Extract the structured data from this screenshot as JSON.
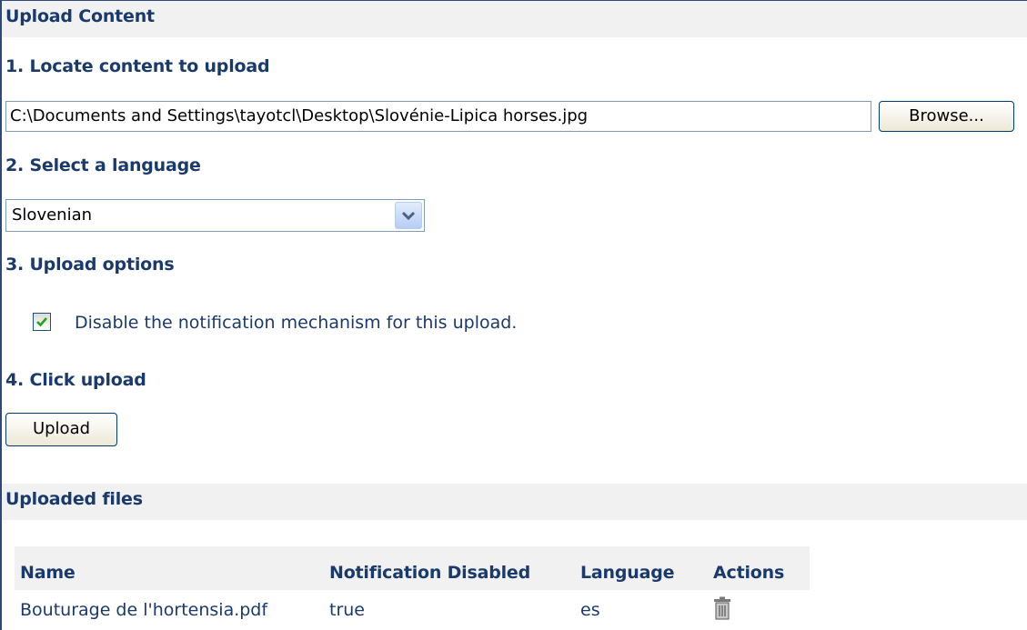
{
  "header": {
    "title": "Upload Content"
  },
  "steps": {
    "locate": {
      "title": "1. Locate content to upload",
      "file_value": "C:\\Documents and Settings\\tayotcl\\Desktop\\Slovénie-Lipica horses.jpg",
      "browse_label": "Browse..."
    },
    "language": {
      "title": "2. Select a language",
      "selected": "Slovenian"
    },
    "options": {
      "title": "3. Upload options",
      "notification_label": "Disable the notification mechanism for this upload.",
      "notification_checked": true
    },
    "upload": {
      "title": "4. Click upload",
      "button_label": "Upload"
    }
  },
  "uploaded": {
    "title": "Uploaded files",
    "columns": [
      "Name",
      "Notification Disabled",
      "Language",
      "Actions"
    ],
    "rows": [
      {
        "name": "Bouturage de l'hortensia.pdf",
        "notification_disabled": "true",
        "language": "es",
        "action_icon": "trash-icon"
      }
    ]
  },
  "colors": {
    "heading": "#1a3a6b",
    "section_bg": "#f1f1f1",
    "frame_border": "#2b4a7a"
  }
}
